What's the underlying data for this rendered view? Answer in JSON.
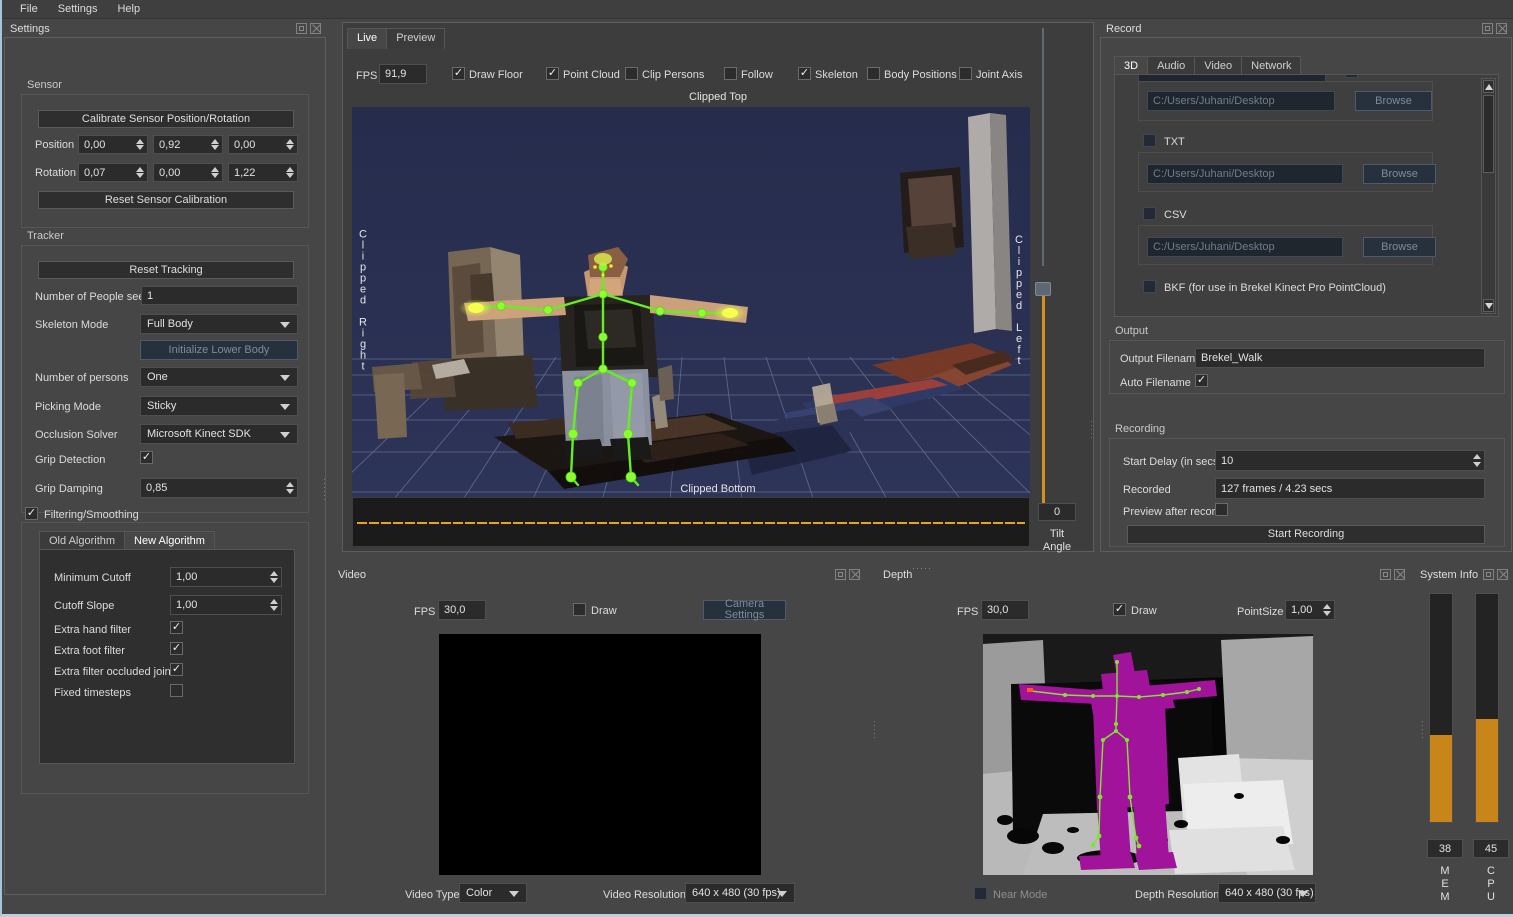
{
  "menubar": {
    "items": [
      "File",
      "Settings",
      "Help"
    ]
  },
  "settings_panel": {
    "title": "Settings",
    "sensor": {
      "label": "Sensor",
      "calibrate_button": "Calibrate Sensor Position/Rotation",
      "position_label": "Position",
      "position_values": [
        "0,00",
        "0,92",
        "0,00"
      ],
      "rotation_label": "Rotation",
      "rotation_values": [
        "0,07",
        "0,00",
        "1,22"
      ],
      "reset_button": "Reset Sensor Calibration"
    },
    "tracker": {
      "label": "Tracker",
      "reset_tracking_button": "Reset Tracking",
      "people_seen_label": "Number of People seen",
      "people_seen_value": "1",
      "skeleton_mode_label": "Skeleton Mode",
      "skeleton_mode_value": "Full Body",
      "init_lower_body_button": "Initialize Lower Body",
      "persons_label": "Number of persons",
      "persons_value": "One",
      "picking_mode_label": "Picking Mode",
      "picking_mode_value": "Sticky",
      "occlusion_solver_label": "Occlusion Solver",
      "occlusion_solver_value": "Microsoft Kinect SDK",
      "grip_detection_label": "Grip Detection",
      "grip_detection_checked": true,
      "grip_damping_label": "Grip Damping",
      "grip_damping_value": "0,85"
    },
    "filtering": {
      "label": "Filtering/Smoothing",
      "enabled": true,
      "tabs": [
        "Old Algorithm",
        "New Algorithm"
      ],
      "active_tab": "New Algorithm",
      "min_cutoff_label": "Minimum Cutoff",
      "min_cutoff_value": "1,00",
      "cutoff_slope_label": "Cutoff Slope",
      "cutoff_slope_value": "1,00",
      "extra_hand_label": "Extra hand filter",
      "extra_hand_checked": true,
      "extra_foot_label": "Extra foot filter",
      "extra_foot_checked": true,
      "extra_occluded_label": "Extra filter occluded joints",
      "extra_occluded_checked": true,
      "fixed_timesteps_label": "Fixed timesteps",
      "fixed_timesteps_checked": false
    }
  },
  "viewer_panel": {
    "tabs": [
      "Live",
      "Preview"
    ],
    "active_tab": "Live",
    "fps_label": "FPS",
    "fps_value": "91,9",
    "toggles": [
      {
        "label": "Draw Floor",
        "checked": true
      },
      {
        "label": "Point Cloud",
        "checked": true
      },
      {
        "label": "Clip Persons",
        "checked": false
      },
      {
        "label": "Follow",
        "checked": false
      },
      {
        "label": "Skeleton",
        "checked": true
      },
      {
        "label": "Body Positions",
        "checked": false
      },
      {
        "label": "Joint Axis",
        "checked": false
      }
    ],
    "clipped_top": "Clipped Top",
    "clipped_bottom": "Clipped Bottom",
    "clipped_right": "Clipped Right",
    "clipped_left": "Clipped Left",
    "tilt_angle_label": "Tilt Angle",
    "tilt_angle_value": "0"
  },
  "record_panel": {
    "title": "Record",
    "tabs": [
      "3D",
      "Audio",
      "Video",
      "Network"
    ],
    "active_tab": "3D",
    "formats": [
      {
        "label": "",
        "checked": false,
        "path": "C:/Users/Juhani/Desktop",
        "browse": "Browse"
      },
      {
        "label": "TXT",
        "checked": false,
        "path": "C:/Users/Juhani/Desktop",
        "browse": "Browse"
      },
      {
        "label": "CSV",
        "checked": false,
        "path": "C:/Users/Juhani/Desktop",
        "browse": "Browse"
      }
    ],
    "bkf_label": "BKF (for use in Brekel Kinect Pro PointCloud)",
    "bkf_checked": false,
    "output": {
      "label": "Output",
      "filename_label": "Output Filename",
      "filename_value": "Brekel_Walk",
      "auto_filename_label": "Auto Filename",
      "auto_filename_checked": true
    },
    "recording": {
      "label": "Recording",
      "start_delay_label": "Start Delay (in secs)",
      "start_delay_value": "10",
      "recorded_label": "Recorded",
      "recorded_value": "127 frames / 4.23 secs",
      "preview_after_label": "Preview after record",
      "preview_after_checked": false,
      "start_button": "Start Recording"
    }
  },
  "video_panel": {
    "title": "Video",
    "fps_label": "FPS",
    "fps_value": "30,0",
    "draw_label": "Draw",
    "draw_checked": false,
    "camera_settings_button": "Camera Settings",
    "video_type_label": "Video Type",
    "video_type_value": "Color",
    "video_resolution_label": "Video Resolution",
    "video_resolution_value": "640 x 480  (30 fps)"
  },
  "depth_panel": {
    "title": "Depth",
    "fps_label": "FPS",
    "fps_value": "30,0",
    "draw_label": "Draw",
    "draw_checked": true,
    "pointsize_label": "PointSize",
    "pointsize_value": "1,00",
    "near_mode_label": "Near Mode",
    "near_mode_checked": false,
    "depth_resolution_label": "Depth Resolution",
    "depth_resolution_value": "640 x 480 (30 fps)"
  },
  "system_info": {
    "title": "System Info",
    "meters": [
      {
        "name": "MEM",
        "value": "38",
        "percent": 38,
        "letters": [
          "M",
          "E",
          "M"
        ]
      },
      {
        "name": "CPU",
        "value": "45",
        "percent": 45,
        "letters": [
          "C",
          "P",
          "U"
        ]
      }
    ],
    "accent_color": "#c8861a"
  }
}
